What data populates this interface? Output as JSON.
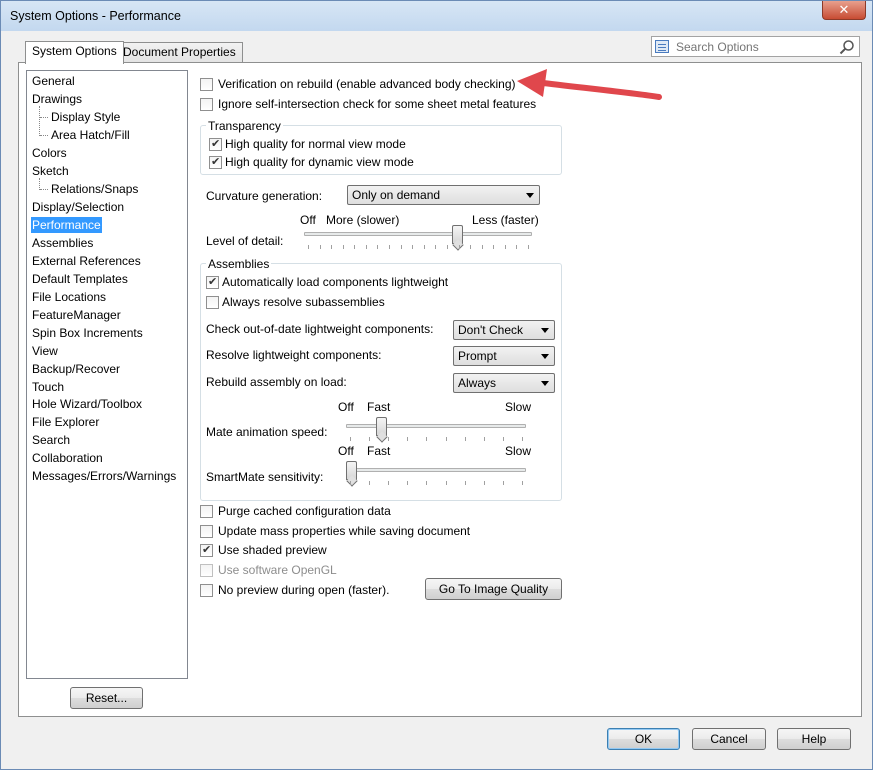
{
  "window": {
    "title": "System Options - Performance",
    "close_glyph": "✕"
  },
  "tabs": [
    {
      "label": "System Options",
      "active": true
    },
    {
      "label": "Document Properties",
      "active": false
    }
  ],
  "search": {
    "placeholder": "Search Options",
    "value": ""
  },
  "tree": {
    "items": [
      {
        "label": "General",
        "level": 0
      },
      {
        "label": "Drawings",
        "level": 0
      },
      {
        "label": "Display Style",
        "level": 1
      },
      {
        "label": "Area Hatch/Fill",
        "level": 1
      },
      {
        "label": "Colors",
        "level": 0
      },
      {
        "label": "Sketch",
        "level": 0
      },
      {
        "label": "Relations/Snaps",
        "level": 1
      },
      {
        "label": "Display/Selection",
        "level": 0
      },
      {
        "label": "Performance",
        "level": 0,
        "selected": true
      },
      {
        "label": "Assemblies",
        "level": 0
      },
      {
        "label": "External References",
        "level": 0
      },
      {
        "label": "Default Templates",
        "level": 0
      },
      {
        "label": "File Locations",
        "level": 0
      },
      {
        "label": "FeatureManager",
        "level": 0
      },
      {
        "label": "Spin Box Increments",
        "level": 0
      },
      {
        "label": "View",
        "level": 0
      },
      {
        "label": "Backup/Recover",
        "level": 0
      },
      {
        "label": "Touch",
        "level": 0
      },
      {
        "label": "Hole Wizard/Toolbox",
        "level": 0
      },
      {
        "label": "File Explorer",
        "level": 0
      },
      {
        "label": "Search",
        "level": 0
      },
      {
        "label": "Collaboration",
        "level": 0
      },
      {
        "label": "Messages/Errors/Warnings",
        "level": 0
      }
    ],
    "reset_label": "Reset..."
  },
  "options": {
    "verification": {
      "label": "Verification on rebuild (enable advanced body checking)",
      "checked": false
    },
    "ignore_self_intersection": {
      "label": "Ignore self-intersection check for some sheet metal features",
      "checked": false
    },
    "transparency": {
      "title": "Transparency",
      "normal": {
        "label": "High quality for normal view mode",
        "checked": true
      },
      "dynamic": {
        "label": "High quality for dynamic view mode",
        "checked": true
      }
    },
    "curvature": {
      "label": "Curvature generation:",
      "value": "Only on demand"
    },
    "level_of_detail": {
      "label": "Level of detail:",
      "off_label": "Off",
      "left_label": "More (slower)",
      "right_label": "Less (faster)",
      "value_fraction": 0.68
    },
    "assemblies": {
      "title": "Assemblies",
      "auto_lightweight": {
        "label": "Automatically load components lightweight",
        "checked": true
      },
      "resolve_sub": {
        "label": "Always resolve subassemblies",
        "checked": false
      },
      "check_out_of_date": {
        "label": "Check out-of-date lightweight components:",
        "value": "Don't Check"
      },
      "resolve_lightweight": {
        "label": "Resolve lightweight components:",
        "value": "Prompt"
      },
      "rebuild_on_load": {
        "label": "Rebuild assembly on load:",
        "value": "Always"
      },
      "mate_animation": {
        "label": "Mate animation speed:",
        "off_label": "Off",
        "fast_label": "Fast",
        "slow_label": "Slow",
        "value_fraction": 0.18
      },
      "smartmate": {
        "label": "SmartMate sensitivity:",
        "off_label": "Off",
        "fast_label": "Fast",
        "slow_label": "Slow",
        "value_fraction": 0.0
      }
    },
    "purge_cached": {
      "label": "Purge cached configuration data",
      "checked": false
    },
    "update_mass": {
      "label": "Update mass properties while saving document",
      "checked": false
    },
    "shaded_preview": {
      "label": "Use shaded preview",
      "checked": true
    },
    "software_opengl": {
      "label": "Use software OpenGL",
      "checked": false,
      "disabled": true
    },
    "no_preview": {
      "label": "No preview during open (faster).",
      "checked": false
    },
    "go_to_image_quality": "Go To Image Quality"
  },
  "footer": {
    "ok": "OK",
    "cancel": "Cancel",
    "help": "Help"
  },
  "annotation": {
    "arrow_color": "#e0474c"
  }
}
